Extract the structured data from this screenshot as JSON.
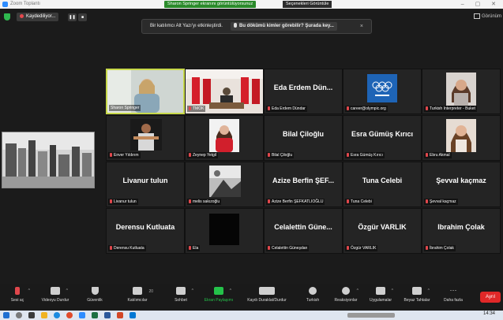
{
  "window": {
    "title": "Zoom Toplantı",
    "share_notice": "Sharon Springer ekranını görüntülüyorsunuz",
    "view_options": "Seçenekleri Görüntüle"
  },
  "header": {
    "recording_label": "Kaydediliyor...",
    "view_label": "Görünüm"
  },
  "banner": {
    "message": "Bir katılımcı Alt Yazı'yı etkinleştirdi.",
    "link": "Bu dökümü kimler görebilir? Şurada key...",
    "close": "×"
  },
  "participants": [
    {
      "label": "Sharon Springer",
      "name": "",
      "video": "woman-office"
    },
    {
      "label": "TMOK",
      "name": "",
      "video": "flags-room"
    },
    {
      "label": "Eda Erdem Dündar",
      "name": "Eda Erdem Dün...",
      "video": ""
    },
    {
      "label": "career@olympic.org",
      "name": "",
      "video": "olympic-logo"
    },
    {
      "label": "Turkish Interpreter - Buket",
      "name": "",
      "video": "woman-portrait"
    },
    {
      "label": "Enver Yıldırım",
      "name": "",
      "video": "man-portrait"
    },
    {
      "label": "Zeynep Yetgil",
      "name": "",
      "video": "woman-red"
    },
    {
      "label": "Bilal Çiloğlu",
      "name": "Bilal Çiloğlu",
      "video": ""
    },
    {
      "label": "Esra Gümüş Kırıcı",
      "name": "Esra Gümüş Kırıcı",
      "video": ""
    },
    {
      "label": "Ebru Akmal",
      "name": "",
      "video": "woman-smile"
    },
    {
      "label": "Livanur tulun",
      "name": "Livanur tulun",
      "video": ""
    },
    {
      "label": "melis sakızoğlu",
      "name": "",
      "video": "bw-photo"
    },
    {
      "label": "Azize Berfin ŞEFKATLIOĞLU",
      "name": "Azize Berfin ŞEF...",
      "video": ""
    },
    {
      "label": "Tuna Celebi",
      "name": "Tuna Celebi",
      "video": ""
    },
    {
      "label": "Şevval kaçmaz",
      "name": "Şevval kaçmaz",
      "video": ""
    },
    {
      "label": "Derensu Kutluata",
      "name": "Derensu Kutluata",
      "video": ""
    },
    {
      "label": "Ela",
      "name": "",
      "video": "black"
    },
    {
      "label": "Celalettin Güneşdan",
      "name": "Celalettin Güne...",
      "video": ""
    },
    {
      "label": "Özgür VARLIK",
      "name": "Özgür VARLIK",
      "video": ""
    },
    {
      "label": "İbrahim Çolak",
      "name": "Ibrahim Çolak",
      "video": ""
    }
  ],
  "toolbar": {
    "unmute": "Sesi aç",
    "stop_video": "Videoyu Durdur",
    "security": "Güvenlik",
    "participants": "Katılımcılar",
    "participants_count": "20",
    "chat": "Sohbet",
    "share_screen": "Ekran Paylaşımı",
    "pause_record": "Kaydı Duraklat/Durdur",
    "interpretation": "Turkish",
    "reactions": "Reaksiyonlar",
    "apps": "Uygulamalar",
    "whiteboards": "Beyaz Tahtalar",
    "more": "Daha fazla",
    "end": "Ayrıl"
  },
  "taskbar": {
    "time": "14:34"
  },
  "colors": {
    "active_speaker": "#c8d94a",
    "share_green": "#24c24a",
    "end_red": "#e02828",
    "zoom_blue": "#2d8cff"
  }
}
